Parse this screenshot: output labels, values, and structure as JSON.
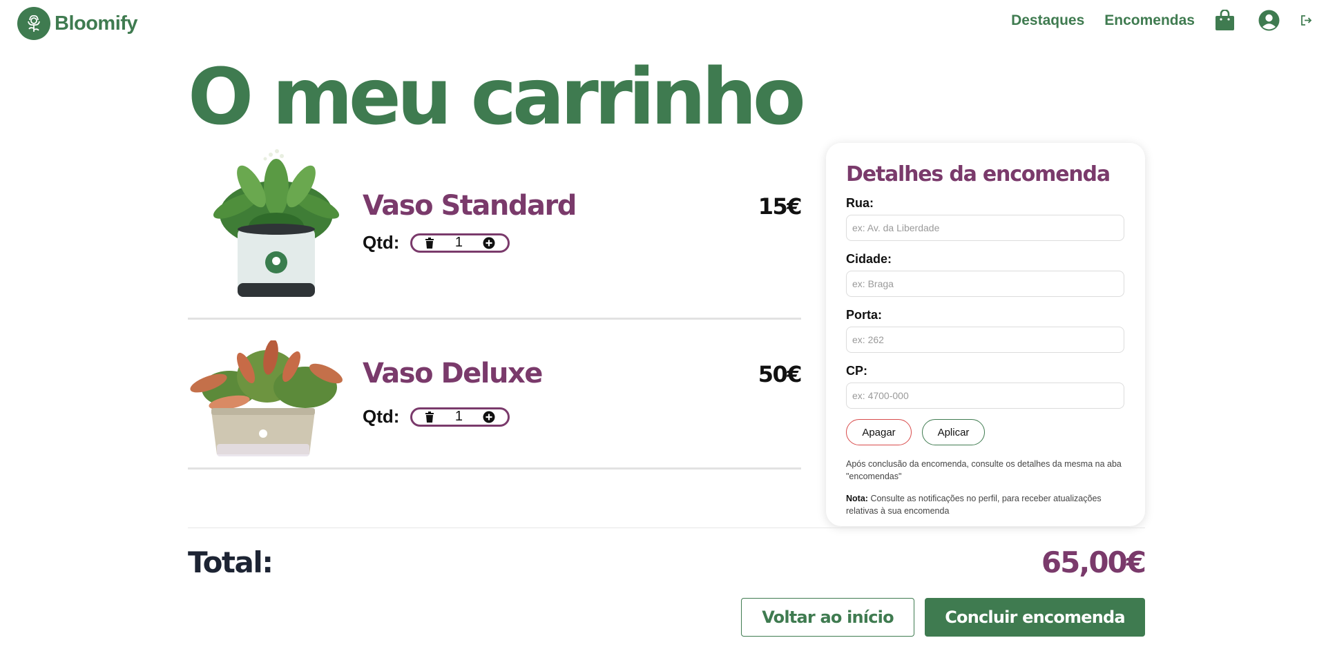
{
  "header": {
    "brand": "Bloomify",
    "nav": {
      "destaques": "Destaques",
      "encomendas": "Encomendas"
    },
    "icons": [
      "rose-logo-icon",
      "shopping-bag-icon",
      "user-account-icon",
      "logout-icon"
    ]
  },
  "page": {
    "title": "O meu carrinho"
  },
  "cart": {
    "qty_label": "Qtd:",
    "items": [
      {
        "name": "Vaso Standard",
        "price": "15€",
        "quantity": "1",
        "image": "potted-leafy-plant"
      },
      {
        "name": "Vaso Deluxe",
        "price": "50€",
        "quantity": "1",
        "image": "planter-box-aglaonema"
      }
    ]
  },
  "order_details": {
    "title": "Detalhes da encomenda",
    "fields": [
      {
        "label": "Rua:",
        "placeholder": "ex: Av. da Liberdade",
        "value": ""
      },
      {
        "label": "Cidade:",
        "placeholder": "ex: Braga",
        "value": ""
      },
      {
        "label": "Porta:",
        "placeholder": "ex: 262",
        "value": ""
      },
      {
        "label": "CP:",
        "placeholder": "ex: 4700-000",
        "value": ""
      }
    ],
    "clear_label": "Apagar",
    "apply_label": "Aplicar",
    "info": "Após conclusão da encomenda, consulte os detalhes da mesma na aba \"encomendas\"",
    "note_prefix": "Nota:",
    "note": "Consulte as notificações no perfil, para receber atualizações relativas à sua encomenda"
  },
  "summary": {
    "total_label": "Total:",
    "total_value": "65,00€",
    "back_label": "Voltar ao início",
    "finish_label": "Concluir encomenda"
  },
  "colors": {
    "brand_green": "#3f7b50",
    "accent_purple": "#7a3a6b",
    "danger_red": "#d84a4a"
  }
}
